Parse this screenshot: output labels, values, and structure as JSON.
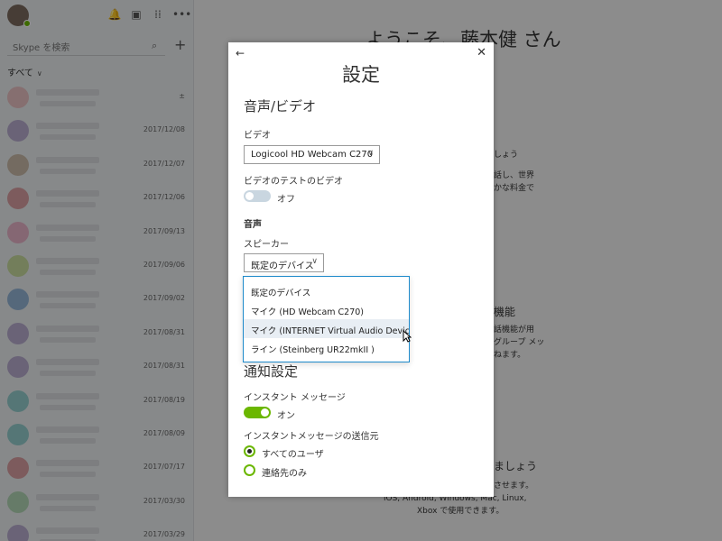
{
  "sidebar": {
    "search_placeholder": "Skype を検索",
    "filter_label": "すべて",
    "contacts": [
      {
        "date": "±",
        "color": "#e58c8c"
      },
      {
        "date": "2017/12/08",
        "color": "#7b5ea7"
      },
      {
        "date": "2017/12/07",
        "color": "#a07a50"
      },
      {
        "date": "2017/12/06",
        "color": "#c04040"
      },
      {
        "date": "2017/09/13",
        "color": "#e36d96"
      },
      {
        "date": "2017/09/06",
        "color": "#9ec33b"
      },
      {
        "date": "2017/09/02",
        "color": "#2a6fb5"
      },
      {
        "date": "2017/08/31",
        "color": "#7b5ea7"
      },
      {
        "date": "2017/08/31",
        "color": "#7b5ea7"
      },
      {
        "date": "2017/08/19",
        "color": "#2aa7a0"
      },
      {
        "date": "2017/08/09",
        "color": "#2aa7a0"
      },
      {
        "date": "2017/07/17",
        "color": "#c04040"
      },
      {
        "date": "2017/03/30",
        "color": "#6bb76b"
      },
      {
        "date": "2017/03/29",
        "color": "#7b5ea7"
      }
    ]
  },
  "background": {
    "welcome": "ようこそ、藤本健 さん",
    "text1_a": "しょう",
    "text1_b": "話し、世界",
    "text1_c": "かな料金で",
    "head2": "機能",
    "text2_a": "話機能が用",
    "text2_b": "グループ メッ",
    "text2_c": "ねます。",
    "head3": "ましょう",
    "text3_a": "させます。",
    "text3_b": "iOS, Android, Windows, Mac, Linux,",
    "text3_c": "Xbox で使用できます。"
  },
  "dialog": {
    "title": "設定",
    "section_av": "音声/ビデオ",
    "video_label": "ビデオ",
    "video_device": "Logicool HD Webcam C270",
    "test_video_label": "ビデオのテストのビデオ",
    "test_video_state": "オフ",
    "audio_label": "音声",
    "speaker_label": "スピーカー",
    "speaker_value": "既定のデバイス",
    "dropdown_options": [
      "既定のデバイス",
      "マイク (HD Webcam C270)",
      "マイク (INTERNET Virtual Audio Device)",
      "ライン (Steinberg UR22mkII )"
    ],
    "section_notify": "通知設定",
    "im_label": "インスタント メッセージ",
    "im_state": "オン",
    "im_sender_label": "インスタントメッセージの送信元",
    "radio_all": "すべてのユーザ",
    "radio_contacts": "連絡先のみ"
  },
  "colors": {
    "accent_green": "#6bb700",
    "dropdown_border": "#1e8acb"
  }
}
